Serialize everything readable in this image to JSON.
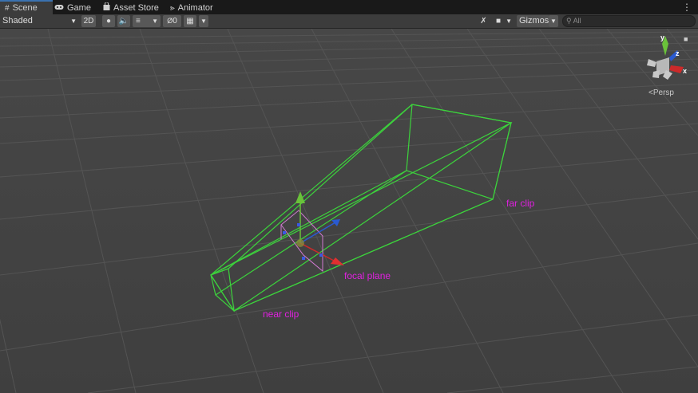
{
  "tabs": {
    "scene": "Scene",
    "game": "Game",
    "asset_store": "Asset Store",
    "animator": "Animator"
  },
  "toolbar": {
    "draw_mode": "Shaded",
    "two_d": "2D",
    "hidden_count": "0",
    "gizmos": "Gizmos",
    "search_placeholder": "All"
  },
  "scene": {
    "persp_label": "Persp",
    "annotations": {
      "near": "near clip",
      "focal": "focal plane",
      "far": "far clip"
    }
  },
  "colors": {
    "frustum": "#3cd23c",
    "annotation": "#e020e0",
    "gizmo_x": "#cc2a2a",
    "gizmo_y": "#6ac23a",
    "gizmo_z": "#2a5ad0",
    "grid_line": "#545454"
  }
}
